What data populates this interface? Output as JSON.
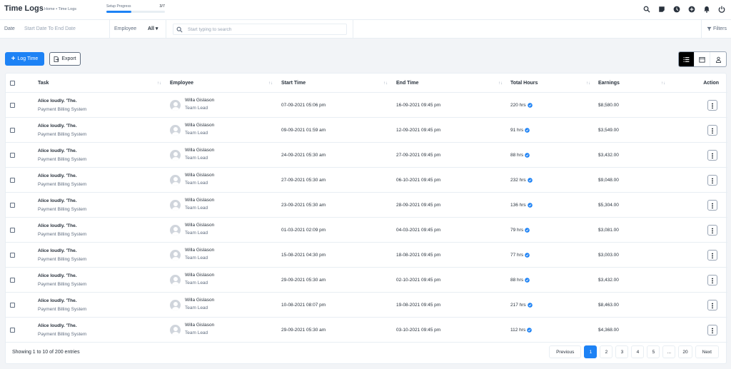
{
  "header": {
    "title": "Time Logs",
    "breadcrumb": "Home • Time Logs",
    "setup_label": "Setup Progress",
    "setup_count": "3/7",
    "setup_progress": 0.43,
    "icons": [
      "search-icon",
      "sticky-note-icon",
      "clock-icon",
      "plus-circle-icon",
      "bell-icon",
      "power-icon"
    ]
  },
  "filters": {
    "date_label": "Date",
    "date_value": "Start Date To End Date",
    "employee_label": "Employee",
    "employee_value": "All",
    "search_placeholder": "Start typing to search",
    "filters_label": "Filters"
  },
  "actions": {
    "log_time_label": "Log Time",
    "export_label": "Export"
  },
  "table": {
    "columns": {
      "task": "Task",
      "employee": "Employee",
      "start_time": "Start Time",
      "end_time": "End Time",
      "total_hours": "Total Hours",
      "earnings": "Earnings",
      "action": "Action"
    },
    "rows": [
      {
        "task": "Alice loudly. 'The.",
        "project": "Payment Billing System",
        "employee": "Willa Gislason",
        "role": "Team Lead",
        "start": "07-09-2021 05:06 pm",
        "end": "16-09-2021 09:45 pm",
        "hours": "220 hrs",
        "earnings": "$8,580.00"
      },
      {
        "task": "Alice loudly. 'The.",
        "project": "Payment Billing System",
        "employee": "Willa Gislason",
        "role": "Team Lead",
        "start": "09-09-2021 01:59 am",
        "end": "12-09-2021 09:45 pm",
        "hours": "91 hrs",
        "earnings": "$3,549.00"
      },
      {
        "task": "Alice loudly. 'The.",
        "project": "Payment Billing System",
        "employee": "Willa Gislason",
        "role": "Team Lead",
        "start": "24-09-2021 05:30 am",
        "end": "27-09-2021 09:45 pm",
        "hours": "88 hrs",
        "earnings": "$3,432.00"
      },
      {
        "task": "Alice loudly. 'The.",
        "project": "Payment Billing System",
        "employee": "Willa Gislason",
        "role": "Team Lead",
        "start": "27-09-2021 05:30 am",
        "end": "06-10-2021 09:45 pm",
        "hours": "232 hrs",
        "earnings": "$9,048.00"
      },
      {
        "task": "Alice loudly. 'The.",
        "project": "Payment Billing System",
        "employee": "Willa Gislason",
        "role": "Team Lead",
        "start": "23-09-2021 05:30 am",
        "end": "28-09-2021 09:45 pm",
        "hours": "136 hrs",
        "earnings": "$5,304.00"
      },
      {
        "task": "Alice loudly. 'The.",
        "project": "Payment Billing System",
        "employee": "Willa Gislason",
        "role": "Team Lead",
        "start": "01-03-2021 02:09 pm",
        "end": "04-03-2021 09:45 pm",
        "hours": "79 hrs",
        "earnings": "$3,081.00"
      },
      {
        "task": "Alice loudly. 'The.",
        "project": "Payment Billing System",
        "employee": "Willa Gislason",
        "role": "Team Lead",
        "start": "15-08-2021 04:30 pm",
        "end": "18-08-2021 09:45 pm",
        "hours": "77 hrs",
        "earnings": "$3,003.00"
      },
      {
        "task": "Alice loudly. 'The.",
        "project": "Payment Billing System",
        "employee": "Willa Gislason",
        "role": "Team Lead",
        "start": "29-09-2021 05:30 am",
        "end": "02-10-2021 09:45 pm",
        "hours": "88 hrs",
        "earnings": "$3,432.00"
      },
      {
        "task": "Alice loudly. 'The.",
        "project": "Payment Billing System",
        "employee": "Willa Gislason",
        "role": "Team Lead",
        "start": "10-08-2021 08:07 pm",
        "end": "19-08-2021 09:45 pm",
        "hours": "217 hrs",
        "earnings": "$8,463.00"
      },
      {
        "task": "Alice loudly. 'The.",
        "project": "Payment Billing System",
        "employee": "Willa Gislason",
        "role": "Team Lead",
        "start": "29-09-2021 05:30 am",
        "end": "03-10-2021 09:45 pm",
        "hours": "112 hrs",
        "earnings": "$4,368.00"
      }
    ]
  },
  "footer": {
    "info": "Showing 1 to 10 of 200 entries",
    "previous": "Previous",
    "pages": [
      "1",
      "2",
      "3",
      "4",
      "5",
      "...",
      "20"
    ],
    "active_page": "1",
    "next": "Next"
  },
  "colors": {
    "accent": "#1d82f5",
    "text": "#28313c",
    "muted": "#616e80",
    "background": "#f2f4f7"
  }
}
